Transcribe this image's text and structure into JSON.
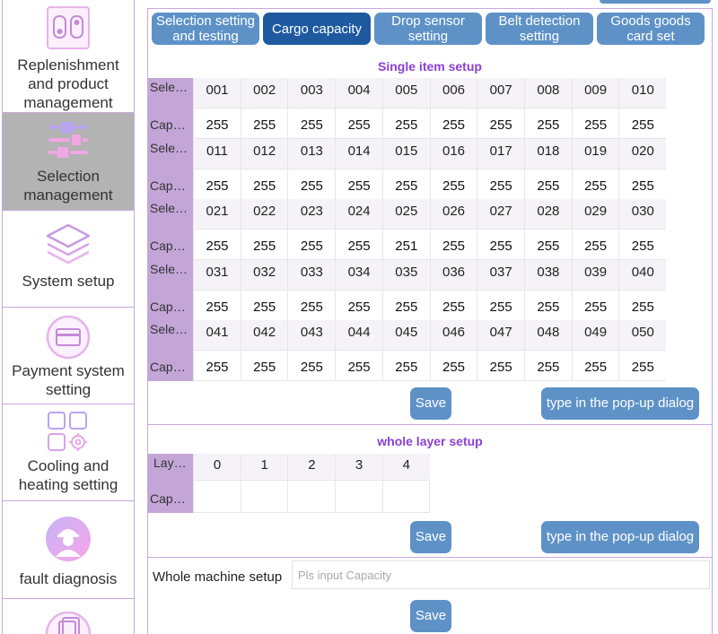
{
  "sidebar": {
    "items": [
      {
        "label": "Replenishment and product management",
        "icon": "robot-icon"
      },
      {
        "label": "Selection management",
        "icon": "sliders-icon",
        "active": true
      },
      {
        "label": "System setup",
        "icon": "layers-icon"
      },
      {
        "label": "Payment system setting",
        "icon": "card-icon"
      },
      {
        "label": "Cooling and heating setting",
        "icon": "grid-gear-icon"
      },
      {
        "label": "fault diagnosis",
        "icon": "engineer-icon"
      },
      {
        "label": "",
        "icon": "documents-icon"
      }
    ]
  },
  "tabs": [
    {
      "label": "Selection setting and testing"
    },
    {
      "label": "Cargo capacity",
      "active": true
    },
    {
      "label": "Drop sensor setting"
    },
    {
      "label": "Belt detection setting"
    },
    {
      "label": "Goods goods card set"
    }
  ],
  "single_item": {
    "title": "Single item setup",
    "row_head_selection": "Selecti…",
    "row_head_capacity": "Capa…",
    "rows": [
      {
        "selections": [
          "001",
          "002",
          "003",
          "004",
          "005",
          "006",
          "007",
          "008",
          "009",
          "010"
        ],
        "capacities": [
          "255",
          "255",
          "255",
          "255",
          "255",
          "255",
          "255",
          "255",
          "255",
          "255"
        ]
      },
      {
        "selections": [
          "011",
          "012",
          "013",
          "014",
          "015",
          "016",
          "017",
          "018",
          "019",
          "020"
        ],
        "capacities": [
          "255",
          "255",
          "255",
          "255",
          "255",
          "255",
          "255",
          "255",
          "255",
          "255"
        ]
      },
      {
        "selections": [
          "021",
          "022",
          "023",
          "024",
          "025",
          "026",
          "027",
          "028",
          "029",
          "030"
        ],
        "capacities": [
          "255",
          "255",
          "255",
          "255",
          "251",
          "255",
          "255",
          "255",
          "255",
          "255"
        ]
      },
      {
        "selections": [
          "031",
          "032",
          "033",
          "034",
          "035",
          "036",
          "037",
          "038",
          "039",
          "040"
        ],
        "capacities": [
          "255",
          "255",
          "255",
          "255",
          "255",
          "255",
          "255",
          "255",
          "255",
          "255"
        ]
      },
      {
        "selections": [
          "041",
          "042",
          "043",
          "044",
          "045",
          "046",
          "047",
          "048",
          "049",
          "050"
        ],
        "capacities": [
          "255",
          "255",
          "255",
          "255",
          "255",
          "255",
          "255",
          "255",
          "255",
          "255"
        ]
      }
    ],
    "save_label": "Save",
    "popup_label": "type in the pop-up dialog"
  },
  "whole_layer": {
    "title": "whole layer setup",
    "row_head_layer": "Layer…",
    "row_head_capacity": "Capa…",
    "layers": [
      "0",
      "1",
      "2",
      "3",
      "4"
    ],
    "save_label": "Save",
    "popup_label": "type in the pop-up dialog"
  },
  "whole_machine": {
    "label": "Whole machine setup",
    "placeholder": "Pls input Capacity",
    "save_label": "Save"
  }
}
